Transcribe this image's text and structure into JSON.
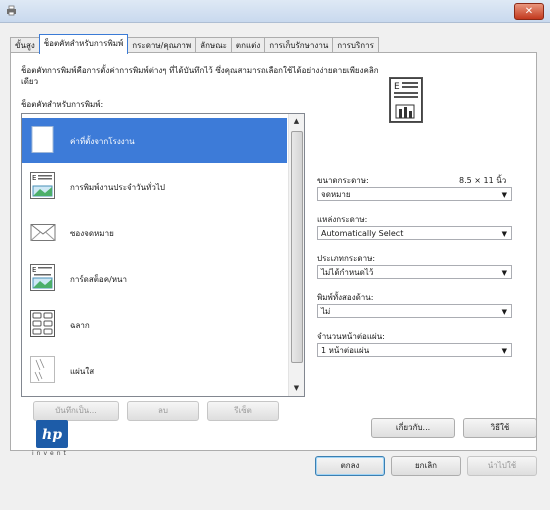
{
  "window": {
    "close_symbol": "✕"
  },
  "tabs": [
    "ขั้นสูง",
    "ช็อตคัทสำหรับการพิมพ์",
    "กระดาษ/คุณภาพ",
    "ลักษณะ",
    "ตกแต่ง",
    "การเก็บรักษางาน",
    "การบริการ"
  ],
  "panel": {
    "description": "ช็อตคัทการพิมพ์คือการตั้งค่าการพิมพ์ต่างๆ ที่ได้บันทึกไว้ ซึ่งคุณสามารถเลือกใช้ได้อย่างง่ายดายเพียงคลิกเดียว",
    "shortcuts_label": "ช็อตคัทสำหรับการพิมพ์:",
    "shortcuts": [
      {
        "label": "ค่าที่ตั้งจากโรงงาน",
        "icon": "blank-page-icon",
        "selected": true
      },
      {
        "label": "การพิมพ์งานประจำวันทั่วไป",
        "icon": "document-with-image-icon",
        "selected": false
      },
      {
        "label": "ซองจดหมาย",
        "icon": "envelope-icon",
        "selected": false
      },
      {
        "label": "การ์ดสต็อค/หนา",
        "icon": "card-stock-icon",
        "selected": false
      },
      {
        "label": "ฉลาก",
        "icon": "labels-grid-icon",
        "selected": false
      },
      {
        "label": "แผ่นใส",
        "icon": "transparency-icon",
        "selected": false
      }
    ],
    "buttons": {
      "save_as": "บันทึกเป็น...",
      "delete": "ลบ",
      "reset": "รีเซ็ต"
    }
  },
  "settings": {
    "paper_size_label": "ขนาดกระดาษ:",
    "paper_size_value": "8.5 × 11 นิ้ว",
    "paper_size_selected": "จดหมาย",
    "paper_source_label": "แหล่งกระดาษ:",
    "paper_source_selected": "Automatically Select",
    "paper_type_label": "ประเภทกระดาษ:",
    "paper_type_selected": "ไม่ได้กำหนดไว้",
    "duplex_label": "พิมพ์ทั้งสองด้าน:",
    "duplex_selected": "ไม่",
    "pages_per_sheet_label": "จำนวนหน้าต่อแผ่น:",
    "pages_per_sheet_selected": "1 หน้าต่อแผ่น"
  },
  "brand": {
    "logo": "hp-logo",
    "tagline": "invent",
    "color": "#1d5ca8"
  },
  "footer": {
    "about": "เกี่ยวกับ...",
    "help": "วิธีใช้",
    "ok": "ตกลง",
    "cancel": "ยกเลิก",
    "apply": "นำไปใช้"
  },
  "colors": {
    "selection": "#3d7bd8",
    "active_tab_border": "#3b7bd6"
  }
}
